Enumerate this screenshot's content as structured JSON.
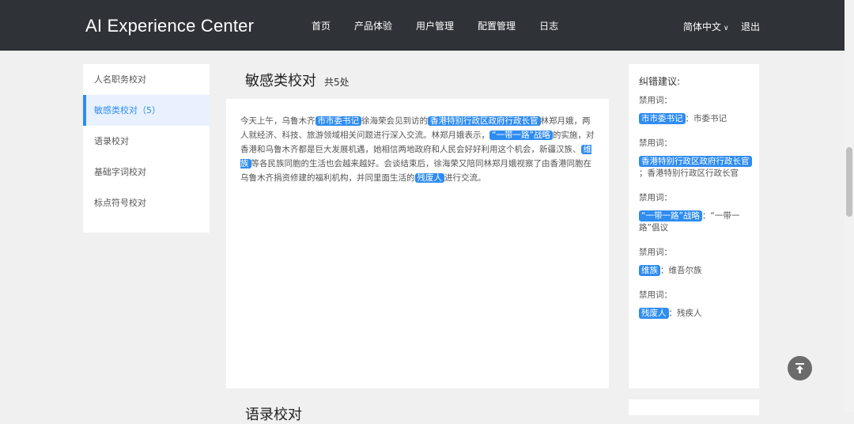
{
  "header": {
    "brand": "AI Experience Center",
    "nav": [
      "首页",
      "产品体验",
      "用户管理",
      "配置管理",
      "日志"
    ],
    "lang": "简体中文",
    "logout": "退出"
  },
  "sidebar": {
    "items": [
      {
        "label": "人名职务校对",
        "active": false
      },
      {
        "label": "敏感类校对（5）",
        "active": true
      },
      {
        "label": "语录校对",
        "active": false
      },
      {
        "label": "基础字词校对",
        "active": false
      },
      {
        "label": "标点符号校对",
        "active": false
      }
    ]
  },
  "main": {
    "title": "敏感类校对",
    "count": "共5处",
    "next_title": "语录校对",
    "segments": [
      {
        "text": "今天上午，乌鲁木齐",
        "hl": false
      },
      {
        "text": "市市委书记",
        "hl": true
      },
      {
        "text": "徐海荣会见到访的",
        "hl": false
      },
      {
        "text": "香港特别行政区政府行政长官",
        "hl": true
      },
      {
        "text": "林郑月娥，两人就经济、科技、旅游领域相关问题进行深入交流。林郑月娥表示，",
        "hl": false
      },
      {
        "text": "“一带一路”战略",
        "hl": true
      },
      {
        "text": "的实施，对香港和乌鲁木齐都是巨大发展机遇，她相信两地政府和人民会好好利用这个机会，新疆汉族、",
        "hl": false
      },
      {
        "text": "维族",
        "hl": true
      },
      {
        "text": "等各民族同胞的生活也会越来越好。会谈结束后，徐海荣又陪同林郑月娥视察了由香港同胞在乌鲁木齐捐资修建的福利机构，并同里面生活的",
        "hl": false
      },
      {
        "text": "残废人",
        "hl": true
      },
      {
        "text": "进行交流。",
        "hl": false
      }
    ]
  },
  "suggestions": {
    "title": "纠错建议:",
    "items": [
      {
        "label": "禁用词：",
        "word": "市市委书记",
        "fix": "：市委书记"
      },
      {
        "label": "禁用词：",
        "word": "香港特别行政区政府行政长官",
        "fix": "；香港特别行政区行政长官"
      },
      {
        "label": "禁用词：",
        "word": "“一带一路”战略",
        "fix": "：“一带一路”倡议"
      },
      {
        "label": "禁用词：",
        "word": "维族",
        "fix": "：维吾尔族"
      },
      {
        "label": "禁用词：",
        "word": "残废人",
        "fix": "：残疾人"
      }
    ]
  },
  "colors": {
    "header_bg": "#2f3237",
    "accent": "#2f8cf0",
    "page_bg": "#f0f0f0"
  },
  "icons": {
    "back_to_top": "arrow-up-to-line-icon",
    "lang_dropdown": "chevron-down-icon"
  }
}
